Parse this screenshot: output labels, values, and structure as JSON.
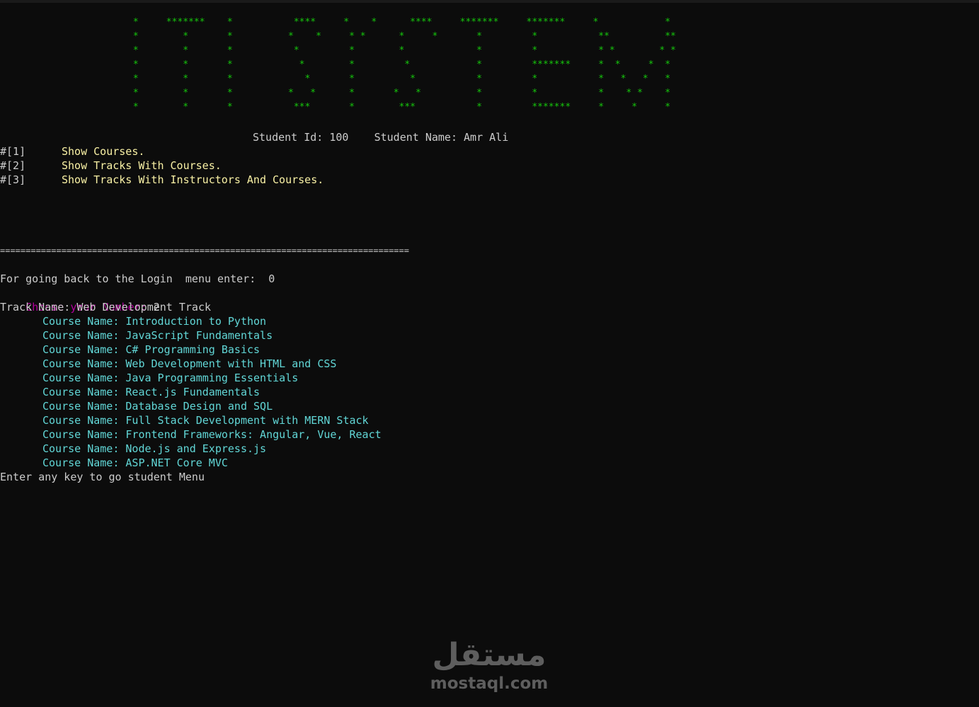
{
  "banner": {
    "rows": [
      "                        *     *******    *           ****     *    *      ****     *******     *******     *            *",
      "                        *        *       *          *    *     * *      *     *       *         *           **          **",
      "                        *        *       *           *         *        *             *         *           * *        * *",
      "                        *        *       *            *        *         *            *         *******     *  *     *  *",
      "                        *        *       *             *       *          *           *         *           *   *   *   *",
      "                        *        *       *          *   *      *       *   *          *         *           *    * *    *",
      "                        *        *       *           ***       *        ***           *         *******     *     *     *"
    ]
  },
  "student_info": "Student Id: 100    Student Name: Amr Ali",
  "menu": [
    {
      "key": "#[1]",
      "label": "Show Courses."
    },
    {
      "key": "#[2]",
      "label": "Show Tracks With Courses."
    },
    {
      "key": "#[3]",
      "label": "Show Tracks With Instructors And Courses."
    }
  ],
  "separator": "================================================================================",
  "back_prompt": "For going back to the Login  menu enter:  0",
  "choose_prompt": "Choose your Number: ",
  "choose_value": "2",
  "track_line": "Track Name: Web Development Track",
  "course_prefix": "Course Name: ",
  "courses": [
    "Introduction to Python",
    "JavaScript Fundamentals",
    "C# Programming Basics",
    "Web Development with HTML and CSS",
    "Java Programming Essentials",
    "React.js Fundamentals",
    "Database Design and SQL",
    "Full Stack Development with MERN Stack",
    "Frontend Frameworks: Angular, Vue, React",
    "Node.js and Express.js",
    "ASP.NET Core MVC"
  ],
  "footer_prompt": "Enter any key to go student Menu",
  "watermark": {
    "arabic": "مستقل",
    "latin": "mostaql.com"
  },
  "colors": {
    "background": "#0c0c0c",
    "banner": "#16c60c",
    "menu": "#f9f1a5",
    "prompt": "#b4009e",
    "course_label": "#3a96dd",
    "course_name": "#61d6d6",
    "text": "#cccccc"
  }
}
